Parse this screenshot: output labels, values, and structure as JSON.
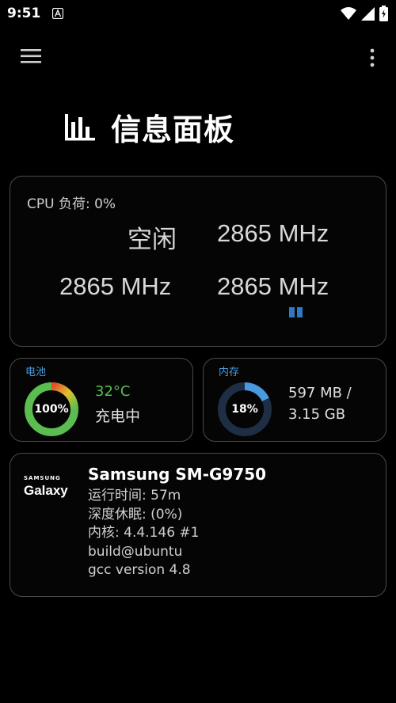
{
  "status": {
    "time": "9:51"
  },
  "header": {
    "title": "信息面板"
  },
  "cpu": {
    "load_label": "CPU 负荷: 0%",
    "cores": [
      "空闲",
      "2865 MHz",
      "2865 MHz",
      "2865 MHz"
    ]
  },
  "battery": {
    "label": "电池",
    "percent_text": "100%",
    "percent": 100,
    "temp": "32°C",
    "state": "充电中"
  },
  "memory": {
    "label": "内存",
    "percent_text": "18%",
    "percent": 18,
    "used": "597 MB /",
    "total": "3.15 GB"
  },
  "device": {
    "brand_small": "SAMSUNG",
    "brand_big": "Galaxy",
    "model": "Samsung SM-G9750",
    "uptime": "运行时间: 57m",
    "deep_sleep": "深度休眠:  (0%)",
    "kernel": "内核: 4.4.146 #1",
    "build": "build@ubuntu",
    "gcc": "gcc version 4.8"
  },
  "colors": {
    "accent": "#4a9ae0",
    "battery_green": "#5bbd4f",
    "memory_track": "#1e2f45"
  },
  "icons": {
    "menu": "hamburger-icon",
    "more": "overflow-icon",
    "title": "bar-chart-icon"
  }
}
